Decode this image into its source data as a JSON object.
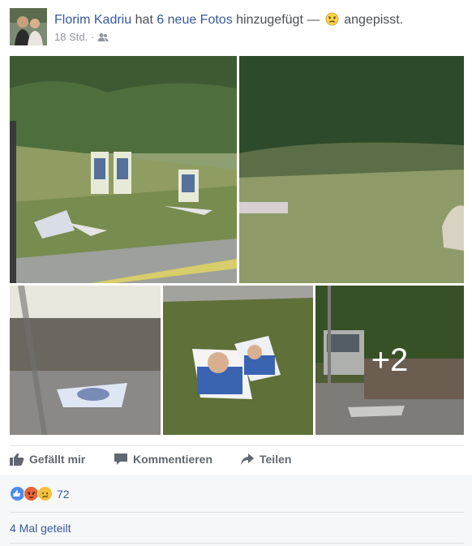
{
  "post": {
    "author": "Florim Kadriu",
    "verb": "hat",
    "photos_link": "6 neue Fotos",
    "action": "hinzugefügt —",
    "feeling": "angepisst.",
    "time": "18 Std.",
    "audience_icon": "friends-icon",
    "more_photos_overlay": "+2"
  },
  "actions": {
    "like": "Gefällt mir",
    "comment": "Kommentieren",
    "share": "Teilen"
  },
  "reactions": {
    "types": [
      "like",
      "angry",
      "sad"
    ],
    "count": "72"
  },
  "shares": "4 Mal geteilt",
  "colors": {
    "link": "#365899",
    "like": "#4a8cf0",
    "angry": "#e8643a",
    "sad": "#f7c03a"
  }
}
